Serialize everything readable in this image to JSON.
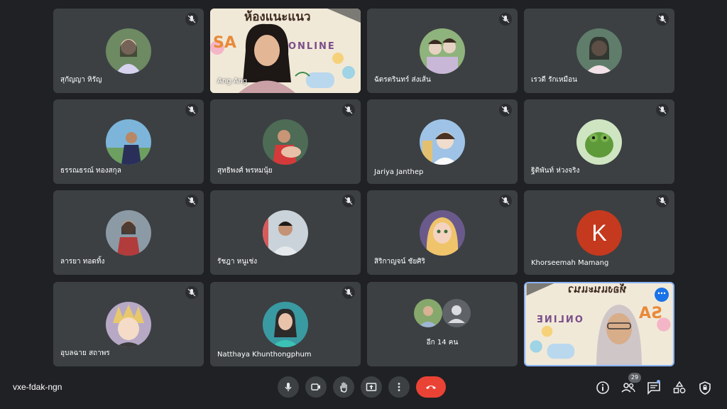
{
  "participants": [
    {
      "name": "สุกัญญา หิรัญ",
      "avatar_color": "#6d8a63",
      "avatar_accent": "#d7d3ee"
    },
    {
      "name": "Ang Ang",
      "video": true
    },
    {
      "name": "ฉัตรตรินทร์ ส่งเส้น",
      "avatar_color": "#8fb37c",
      "avatar_accent": "#e6d2c2"
    },
    {
      "name": "เรวดี รักเหมือน",
      "avatar_color": "#607d6b",
      "avatar_accent": "#f2e2e8"
    },
    {
      "name": "ธรรณธรณ์ ทองสกุล",
      "avatar_color": "#7cb5d9",
      "avatar_accent": "#2a2f5a"
    },
    {
      "name": "สุทธิพงศ์ พรหมนุ้ย",
      "avatar_color": "#4d6b55",
      "avatar_accent": "#d43a3a"
    },
    {
      "name": "Jariya Janthep",
      "avatar_color": "#9ec3e6",
      "avatar_accent": "#f0dccd"
    },
    {
      "name": "ฐิติพันท์ ห่วงจริง",
      "avatar_color": "#cfe5c2",
      "avatar_accent": "#5e9a3a"
    },
    {
      "name": "ลารยา ทอดทิ้ง",
      "avatar_color": "#8b9aa5",
      "avatar_accent": "#b23b3b"
    },
    {
      "name": "รัชฎา หนูเช่ง",
      "avatar_color": "#c9d3d9",
      "avatar_accent": "#5b6c7a"
    },
    {
      "name": "สิริกาญจน์ ชัยศิริ",
      "avatar_color": "#6a5a8c",
      "avatar_accent": "#f0c46a"
    },
    {
      "name": "Khorseemah Mamang",
      "initial": "K",
      "avatar_color": "#c5391f"
    },
    {
      "name": "อุบลฉาย สถาพร",
      "avatar_color": "#b7a9c6",
      "avatar_accent": "#e8c86c"
    },
    {
      "name": "Natthaya Khunthongphum",
      "avatar_color": "#3a9aa2",
      "avatar_accent": "#2d2a2a"
    }
  ],
  "banner": {
    "top_text": "ห้องแนะแนว",
    "online_text": "ONLINE",
    "letters": "SA"
  },
  "more": {
    "label": "อีก 14 คน"
  },
  "self_tile": {
    "menu_glyph": "⋯"
  },
  "meeting": {
    "code": "vxe-fdak-ngn"
  },
  "people_count": "29",
  "colors": {
    "bg": "#202124",
    "tile": "#3c4043",
    "hangup": "#ea4335",
    "accent": "#1a73e8"
  },
  "controls": [
    "mic-icon",
    "camera-icon",
    "raise-hand-icon",
    "present-icon",
    "more-options-icon",
    "end-call-icon"
  ],
  "right_controls": [
    "info-icon",
    "people-icon",
    "chat-icon",
    "activities-icon",
    "host-controls-icon"
  ]
}
